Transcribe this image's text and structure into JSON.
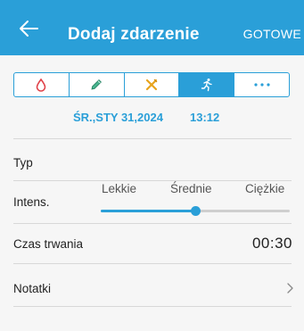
{
  "header": {
    "title": "Dodaj zdarzenie",
    "done_label": "GOTOWE",
    "back_icon": "arrow-left-icon"
  },
  "colors": {
    "accent": "#2a9fd8",
    "blood_drop": "#e0434a",
    "pencil": "#29a77b",
    "food": "#e8a41c"
  },
  "segments": [
    {
      "icon": "blood-drop-icon",
      "active": false
    },
    {
      "icon": "pen-icon",
      "active": false
    },
    {
      "icon": "cutlery-icon",
      "active": false
    },
    {
      "icon": "running-person-icon",
      "active": true
    },
    {
      "icon": "more-icon",
      "active": false
    }
  ],
  "datetime": {
    "date": "ŚR.,STY 31,2024",
    "time": "13:12"
  },
  "form": {
    "type_label": "Typ",
    "intensity_label": "Intens.",
    "intensity_options": [
      "Lekkie",
      "Średnie",
      "Ciężkie"
    ],
    "intensity_value_fraction": 0.5,
    "duration_label": "Czas trwania",
    "duration_value": "00:30",
    "notes_label": "Notatki"
  }
}
